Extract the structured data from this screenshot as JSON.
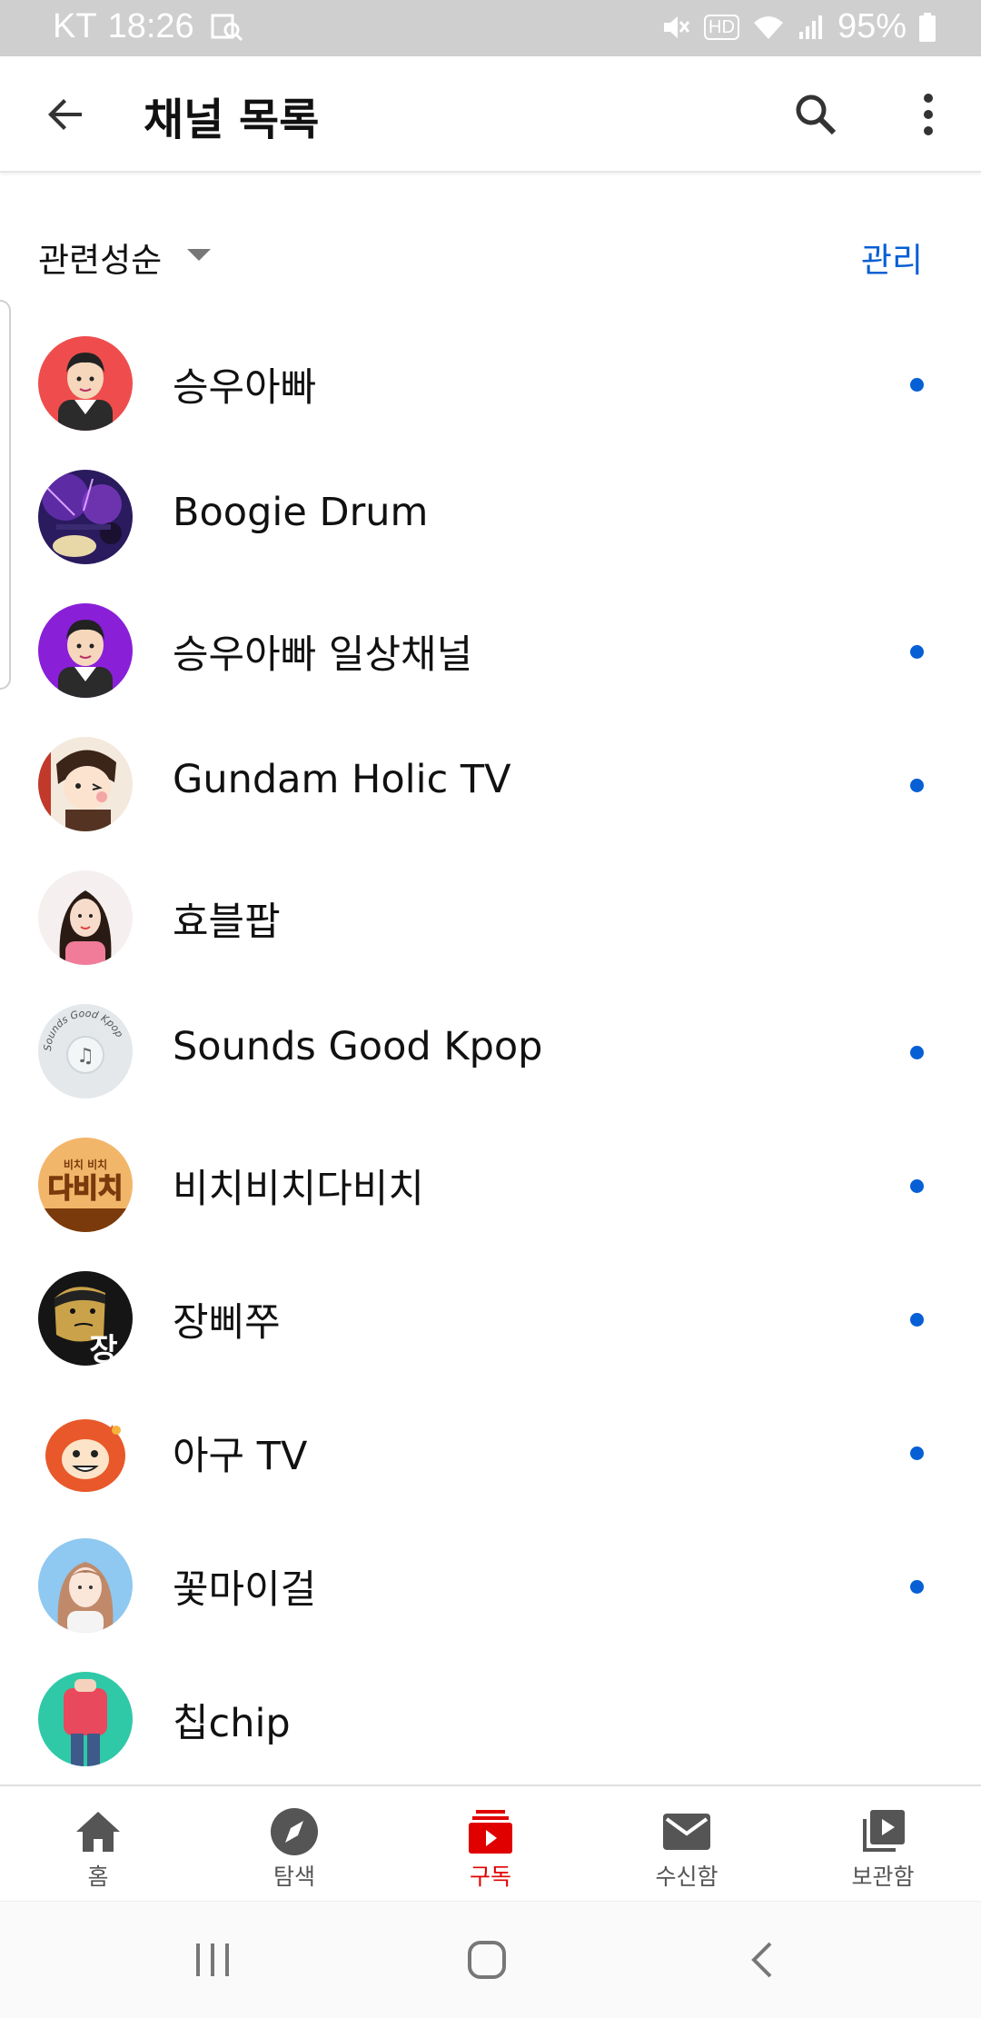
{
  "status_bar": {
    "carrier": "KT",
    "time": "18:26",
    "battery": "95%",
    "hd": "HD"
  },
  "app_bar": {
    "title": "채널 목록"
  },
  "sort": {
    "label": "관련성순",
    "manage": "관리"
  },
  "channels": [
    {
      "name": "승우아빠",
      "new": true
    },
    {
      "name": "Boogie Drum",
      "new": false
    },
    {
      "name": "승우아빠 일상채널",
      "new": true
    },
    {
      "name": "Gundam Holic TV",
      "new": true
    },
    {
      "name": "효블팝",
      "new": false
    },
    {
      "name": "Sounds Good Kpop",
      "new": true
    },
    {
      "name": "비치비치다비치",
      "new": true
    },
    {
      "name": "장삐쭈",
      "new": true
    },
    {
      "name": "아구 TV",
      "new": true
    },
    {
      "name": "꽃마이걸",
      "new": true
    },
    {
      "name": "칩chip",
      "new": false
    }
  ],
  "avatar_texts": {
    "sounds_good_arc": "Sounds Good Kpop",
    "dabichi_small": "비치 비치",
    "dabichi_big": "다비치",
    "jang": "장"
  },
  "bottom_nav": [
    {
      "label": "홈",
      "icon": "home-icon",
      "active": false
    },
    {
      "label": "탐색",
      "icon": "explore-icon",
      "active": false
    },
    {
      "label": "구독",
      "icon": "subscriptions-icon",
      "active": true
    },
    {
      "label": "수신함",
      "icon": "inbox-icon",
      "active": false
    },
    {
      "label": "보관함",
      "icon": "library-icon",
      "active": false
    }
  ],
  "colors": {
    "accent_blue": "#065fd4",
    "active_red": "#e00000",
    "status_bar": "#cfcfcf"
  }
}
